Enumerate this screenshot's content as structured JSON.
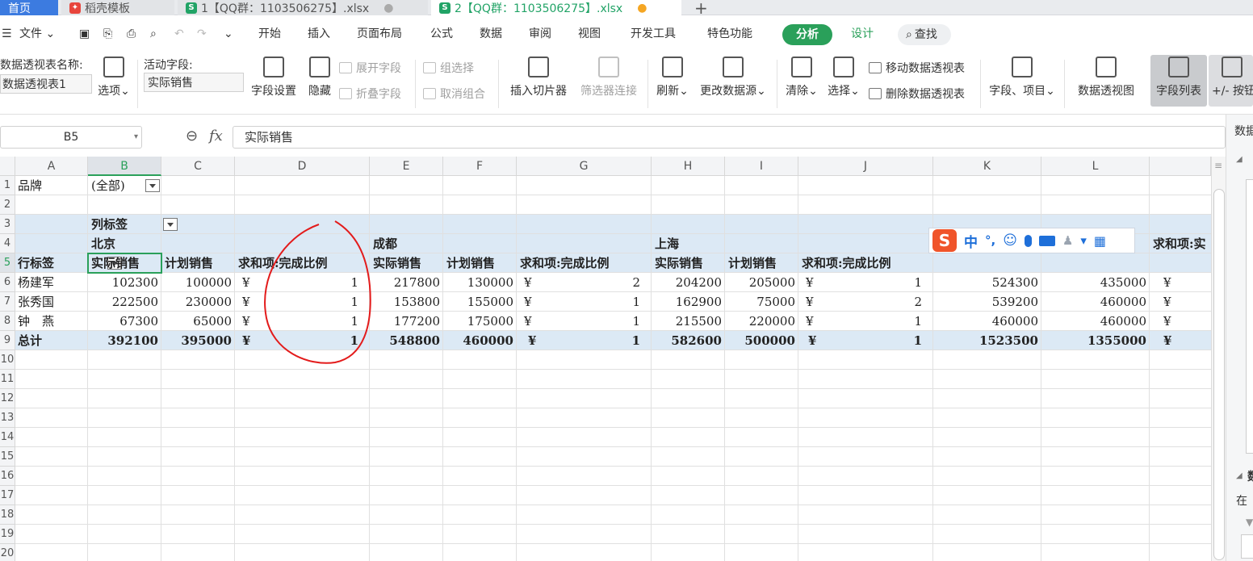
{
  "tabs": [
    {
      "label": "首页",
      "active": false
    },
    {
      "label": "稻壳模板",
      "active": false
    },
    {
      "label": "1【QQ群：1103506275】.xlsx",
      "active": false
    },
    {
      "label": "2【QQ群：1103506275】.xlsx",
      "active": true
    }
  ],
  "menu": {
    "file": "文件",
    "items": [
      "开始",
      "插入",
      "页面布局",
      "公式",
      "数据",
      "审阅",
      "视图",
      "开发工具",
      "特色功能"
    ],
    "analyze": "分析",
    "design": "设计",
    "search": "查找"
  },
  "ribbon": {
    "pivot_name_label": "数据透视表名称:",
    "pivot_name_value": "数据透视表1",
    "options": "选项",
    "active_field_label": "活动字段:",
    "active_field_value": "实际销售",
    "field_settings": "字段设置",
    "hide": "隐藏",
    "expand_field": "展开字段",
    "collapse_field": "折叠字段",
    "group_selection": "组选择",
    "ungroup": "取消组合",
    "insert_slicer": "插入切片器",
    "filter_connections": "筛选器连接",
    "refresh": "刷新",
    "change_source": "更改数据源",
    "clear": "清除",
    "select": "选择",
    "move_pivot": "移动数据透视表",
    "delete_pivot": "删除数据透视表",
    "fields_items": "字段、项目",
    "pivot_chart": "数据透视图",
    "field_list": "字段列表",
    "buttons": "+/- 按钮"
  },
  "formula": {
    "name_box": "B5",
    "fx": "fx",
    "value": "实际销售"
  },
  "columns": [
    "A",
    "B",
    "C",
    "D",
    "E",
    "F",
    "G",
    "H",
    "I",
    "J",
    "K",
    "L"
  ],
  "rows": [
    "1",
    "2",
    "3",
    "4",
    "5",
    "6",
    "7",
    "8",
    "9",
    "10",
    "11",
    "12",
    "13",
    "14",
    "15",
    "16",
    "17",
    "18",
    "19",
    "20"
  ],
  "pivot": {
    "filter_label": "品牌",
    "filter_value": "(全部)",
    "col_label": "列标签",
    "row_label": "行标签",
    "cities": [
      "北京",
      "成都",
      "上海"
    ],
    "total_header": "求和项:实",
    "headers": [
      "实际销售",
      "计划销售",
      "求和项:完成比例"
    ],
    "currency": "¥",
    "data_rows": [
      {
        "name": "杨建军",
        "values": [
          "102300",
          "100000",
          "1",
          "217800",
          "130000",
          "2",
          "204200",
          "205000",
          "1",
          "524300",
          "435000"
        ]
      },
      {
        "name": "张秀国",
        "values": [
          "222500",
          "230000",
          "1",
          "153800",
          "155000",
          "1",
          "162900",
          "75000",
          "2",
          "539200",
          "460000"
        ]
      },
      {
        "name": "钟　燕",
        "values": [
          "67300",
          "65000",
          "1",
          "177200",
          "175000",
          "1",
          "215500",
          "220000",
          "1",
          "460000",
          "460000"
        ]
      }
    ],
    "total": {
      "name": "总计",
      "values": [
        "392100",
        "395000",
        "1",
        "548800",
        "460000",
        "1",
        "582600",
        "500000",
        "1",
        "1523500",
        "1355000"
      ]
    }
  },
  "ime": {
    "mode": "中",
    "punct": "°,"
  },
  "sidepanel": {
    "title": "数据",
    "section2": "数",
    "note": "在"
  }
}
